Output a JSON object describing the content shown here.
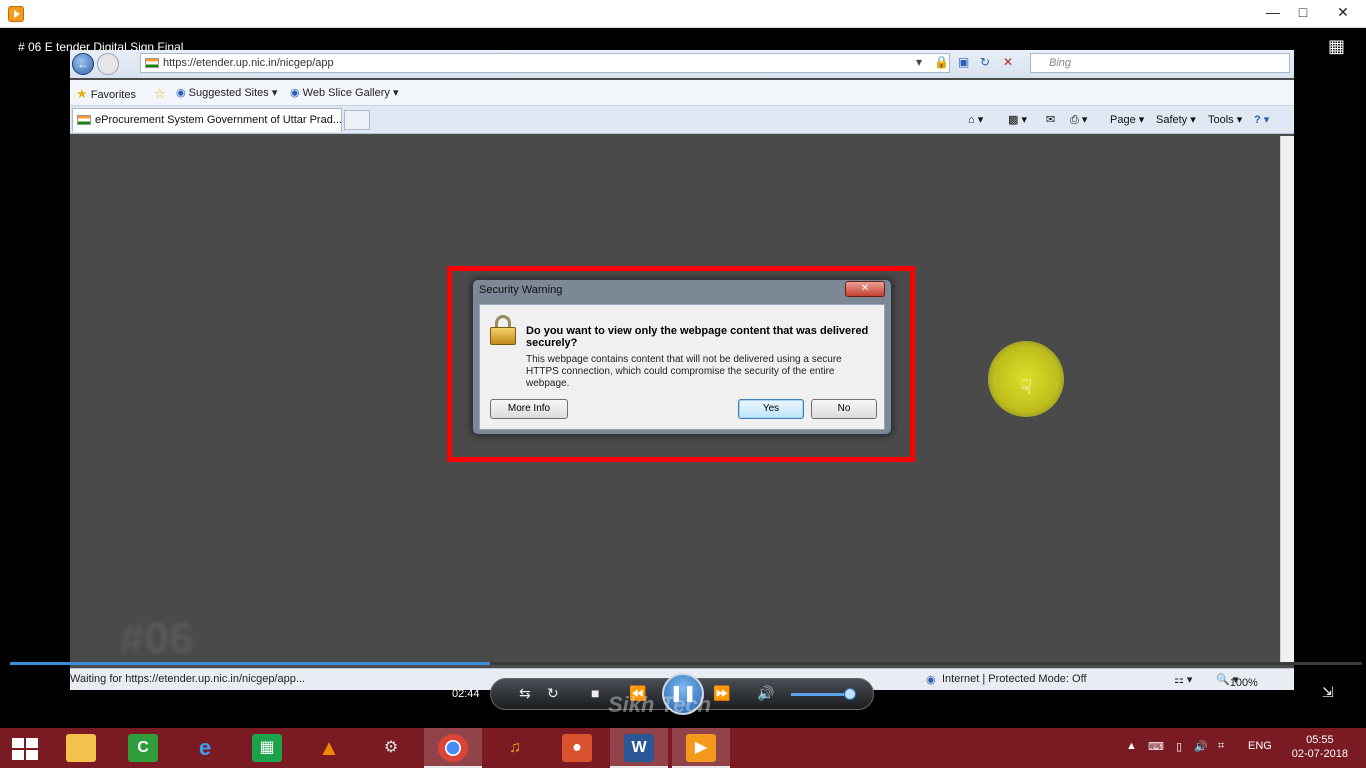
{
  "player": {
    "video_title": "# 06 E tender Digital Sign Final",
    "time": "02:44",
    "watermark": "Sikh Tech"
  },
  "browser": {
    "url": "https://etender.up.nic.in/nicgep/app",
    "search_placeholder": "Bing",
    "favorites_label": "Favorites",
    "suggested_sites": "Suggested Sites",
    "web_slice_gallery": "Web Slice Gallery",
    "tab_title": "eProcurement System Government of Uttar Prad...",
    "commands": {
      "page": "Page",
      "safety": "Safety",
      "tools": "Tools"
    },
    "status_text": "Waiting for https://etender.up.nic.in/nicgep/app...",
    "zone_text": "Internet | Protected Mode: Off",
    "zoom": "100%",
    "watermark_big": "#06"
  },
  "dialog": {
    "title": "Security Warning",
    "question": "Do you want to view only the webpage content that was delivered securely?",
    "description": "This webpage contains content that will not be delivered using a secure HTTPS connection, which could compromise the security of the entire webpage.",
    "more_info": "More Info",
    "yes": "Yes",
    "no": "No"
  },
  "taskbar": {
    "language": "ENG",
    "time": "05:55",
    "date": "02-07-2018"
  },
  "colors": {
    "highlight": "#ff0000",
    "taskbar": "#7a1a22",
    "accent": "#3c8de0"
  }
}
